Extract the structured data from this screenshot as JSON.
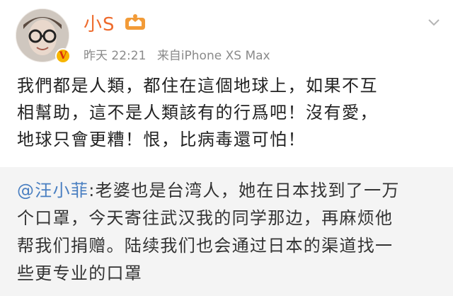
{
  "post": {
    "username": "小S",
    "meta_time": "昨天 22:21",
    "meta_source": "来自iPhone XS Max",
    "text_lines": [
      "我們都是人類，都住在這個地球上，如果不互",
      "相幫助，這不是人類該有的行爲吧！沒有愛，",
      "地球只會更糟！恨，比病毒還可怕！"
    ]
  },
  "repost": {
    "author": "@汪小菲",
    "separator": ":",
    "lines": [
      "老婆也是台湾人，她在日本找到了一万",
      "个口罩，今天寄往武汉我的同学那边，再麻烦他",
      "帮我们捐赠。陆续我们也会通过日本的渠道找一",
      "些更专业的口罩"
    ]
  },
  "icons": {
    "avatar": "avatar-photo",
    "vip": "verified-v-icon",
    "member": "member-crown-icon",
    "menu": "chevron-down-icon"
  },
  "colors": {
    "username": "#ee6b2d",
    "link": "#4a7fc1",
    "repost_bg": "#f4f4f4",
    "meta": "#8a8a8a"
  }
}
